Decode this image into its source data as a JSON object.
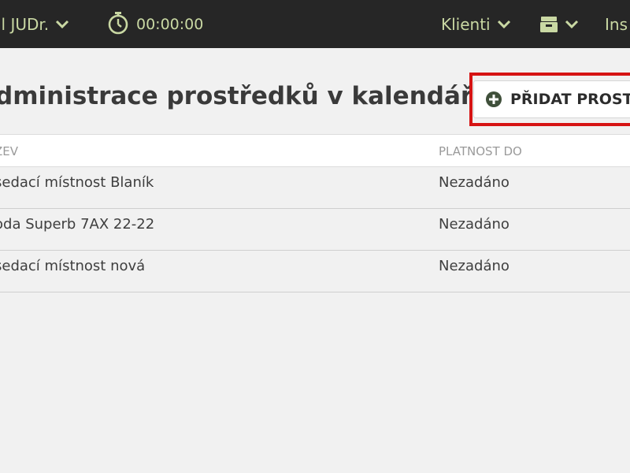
{
  "topbar": {
    "user_label": "il JUDr.",
    "timer": "00:00:00",
    "clients_label": "Klienti",
    "inbox_label": "Ins",
    "colors": {
      "background": "#262626",
      "text": "#c9d8a3"
    },
    "icons": {
      "user_menu": "chevron-down-icon",
      "timer": "stopwatch-icon",
      "clients_menu": "chevron-down-icon",
      "tray": "archive-box-icon"
    }
  },
  "page": {
    "title": "dministrace prostředků v kalendáři",
    "add_button_label": "PŘIDAT PROSTŘ",
    "add_button_icon": "plus-circle-icon",
    "highlight_color": "#d61414"
  },
  "table": {
    "columns": [
      "ZEV",
      "PLATNOST DO"
    ],
    "rows": [
      {
        "name": "sedací místnost Blaník",
        "valid_until": "Nezadáno"
      },
      {
        "name": "oda Superb 7AX 22-22",
        "valid_until": "Nezadáno"
      },
      {
        "name": "sedací místnost nová",
        "valid_until": "Nezadáno"
      }
    ]
  }
}
